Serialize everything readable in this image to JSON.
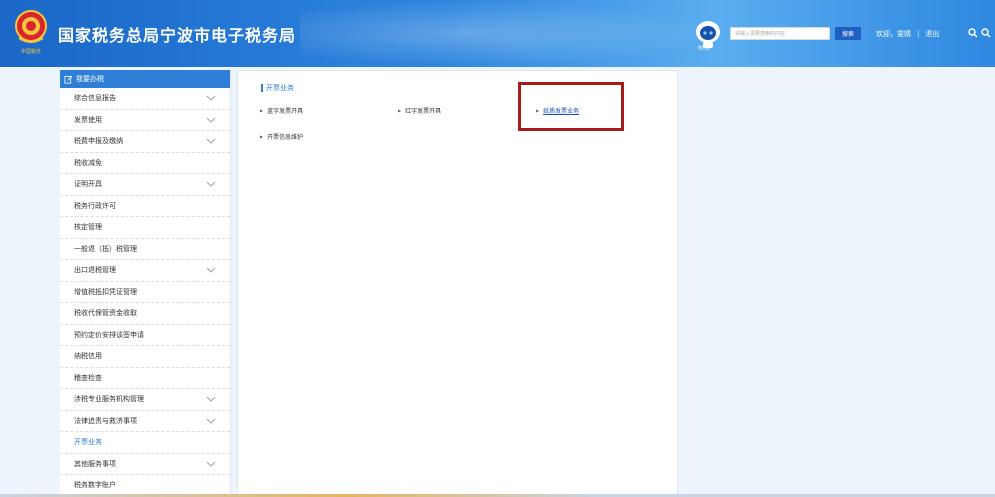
{
  "header": {
    "emblem_caption": "中国税务",
    "title": "国家税务总局宁波市电子税务局",
    "robot_label": "智税宝",
    "search_placeholder": "请输入需要搜索的内容",
    "search_button": "搜索",
    "welcome": "欢迎，雯婧",
    "separator": "|",
    "logout": "退出",
    "zoom_in_icon": "zoom-in-icon",
    "zoom_out_icon": "zoom-out-icon"
  },
  "sidebar": {
    "title": "我要办税",
    "items": [
      {
        "label": "综合信息报告",
        "expandable": true
      },
      {
        "label": "发票使用",
        "expandable": true
      },
      {
        "label": "税费申报及缴纳",
        "expandable": true
      },
      {
        "label": "税收减免",
        "expandable": false
      },
      {
        "label": "证明开具",
        "expandable": true
      },
      {
        "label": "税务行政许可",
        "expandable": false
      },
      {
        "label": "核定管理",
        "expandable": false
      },
      {
        "label": "一般退（抵）税管理",
        "expandable": false
      },
      {
        "label": "出口退税管理",
        "expandable": true
      },
      {
        "label": "增值税抵扣凭证管理",
        "expandable": false
      },
      {
        "label": "税收代保管资金收取",
        "expandable": false
      },
      {
        "label": "预约定价安排谈签申请",
        "expandable": false
      },
      {
        "label": "纳税信用",
        "expandable": false
      },
      {
        "label": "稽查检查",
        "expandable": false
      },
      {
        "label": "涉税专业服务机构管理",
        "expandable": true
      },
      {
        "label": "法律追责与救济事项",
        "expandable": true
      },
      {
        "label": "开票业务",
        "expandable": false,
        "active": true
      },
      {
        "label": "其他服务事项",
        "expandable": true
      },
      {
        "label": "税务数字账户",
        "expandable": false
      }
    ]
  },
  "main": {
    "section_title": "开票业务",
    "links": [
      {
        "label": "蓝字发票开具"
      },
      {
        "label": "红字发票开具"
      },
      {
        "label": "纸质发票业务",
        "highlight": true
      },
      {
        "label": "开票信息维护"
      }
    ]
  },
  "colors": {
    "header_blue": "#2e86df",
    "accent": "#2f7fd8",
    "highlight_box": "#a61b1b"
  }
}
